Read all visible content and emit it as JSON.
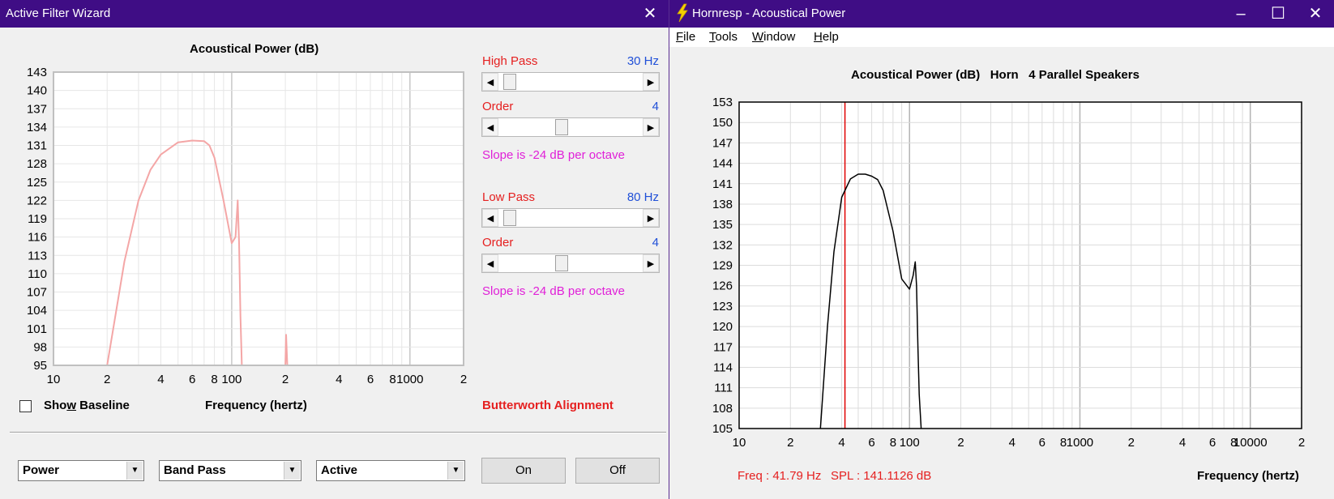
{
  "left_window": {
    "title": "Active Filter Wizard",
    "close_glyph": "✕",
    "chart": {
      "title": "Acoustical Power (dB)",
      "y_ticks": [
        "143",
        "140",
        "137",
        "134",
        "131",
        "128",
        "125",
        "122",
        "119",
        "116",
        "113",
        "110",
        "107",
        "104",
        "101",
        "98",
        "95"
      ],
      "x_ticks": [
        "10",
        "2",
        "4",
        "6",
        "8",
        "100",
        "2",
        "4",
        "6",
        "8",
        "1000",
        "2"
      ],
      "xlabel": "Frequency (hertz)"
    },
    "high_pass": {
      "label": "High Pass",
      "value": "30 Hz",
      "order_label": "Order",
      "order_value": "4",
      "slope": "Slope is -24 dB per octave"
    },
    "low_pass": {
      "label": "Low Pass",
      "value": "80 Hz",
      "order_label": "Order",
      "order_value": "4",
      "slope": "Slope is -24 dB per octave"
    },
    "show_baseline": {
      "label_pre": "Sho",
      "label_u": "w",
      "label_post": " Baseline",
      "checked": false
    },
    "alignment": "Butterworth Alignment",
    "dropdowns": {
      "mode": "Power",
      "filter": "Band Pass",
      "type": "Active"
    },
    "buttons": {
      "on": "On",
      "off": "Off"
    }
  },
  "right_window": {
    "title": "Hornresp - Acoustical Power",
    "menu": [
      {
        "u": "F",
        "rest": "ile"
      },
      {
        "u": "T",
        "rest": "ools"
      },
      {
        "u": "W",
        "rest": "indow"
      },
      {
        "u": "H",
        "rest": "elp"
      }
    ],
    "chart": {
      "title": "Acoustical Power (dB)   Horn   4 Parallel Speakers",
      "y_ticks": [
        "153",
        "150",
        "147",
        "144",
        "141",
        "138",
        "135",
        "132",
        "129",
        "126",
        "123",
        "120",
        "117",
        "114",
        "111",
        "108",
        "105"
      ],
      "x_ticks": [
        "10",
        "2",
        "4",
        "6",
        "8",
        "100",
        "2",
        "4",
        "6",
        "8",
        "1000",
        "2",
        "4",
        "6",
        "8",
        "10000",
        "2"
      ],
      "xlabel": "Frequency (hertz)"
    },
    "cursor": {
      "freq": "Freq : 41.79 Hz",
      "spl": "SPL : 141.1126 dB"
    }
  },
  "chart_data": [
    {
      "type": "line",
      "title": "Acoustical Power (dB)",
      "xlabel": "Frequency (hertz)",
      "ylabel": "",
      "x_scale": "log",
      "xlim": [
        10,
        2000
      ],
      "ylim": [
        95,
        143
      ],
      "grid": true,
      "series": [
        {
          "color": "#f4a6a6",
          "x": [
            20,
            25,
            30,
            35,
            40,
            50,
            60,
            70,
            75,
            80,
            90,
            100,
            105,
            108,
            110,
            112,
            114,
            200,
            202,
            205
          ],
          "y": [
            95,
            112,
            122,
            127,
            129.5,
            131.5,
            131.8,
            131.7,
            131,
            129,
            122,
            115,
            116,
            122,
            115,
            103,
            95,
            95,
            100,
            95
          ]
        }
      ]
    },
    {
      "type": "line",
      "title": "Acoustical Power (dB)   Horn   4 Parallel Speakers",
      "xlabel": "Frequency (hertz)",
      "ylabel": "",
      "x_scale": "log",
      "xlim": [
        10,
        20000
      ],
      "ylim": [
        105,
        153
      ],
      "grid": true,
      "cursor_x": 41.79,
      "series": [
        {
          "color": "#000000",
          "x": [
            30,
            33,
            36,
            40,
            45,
            50,
            55,
            60,
            65,
            70,
            80,
            90,
            100,
            105,
            108,
            110,
            112,
            114,
            117
          ],
          "y": [
            105,
            120,
            131,
            139,
            141.7,
            142.4,
            142.4,
            142.1,
            141.6,
            140,
            134,
            127,
            125.5,
            127.5,
            129.5,
            126,
            117,
            110,
            105
          ]
        }
      ]
    }
  ]
}
